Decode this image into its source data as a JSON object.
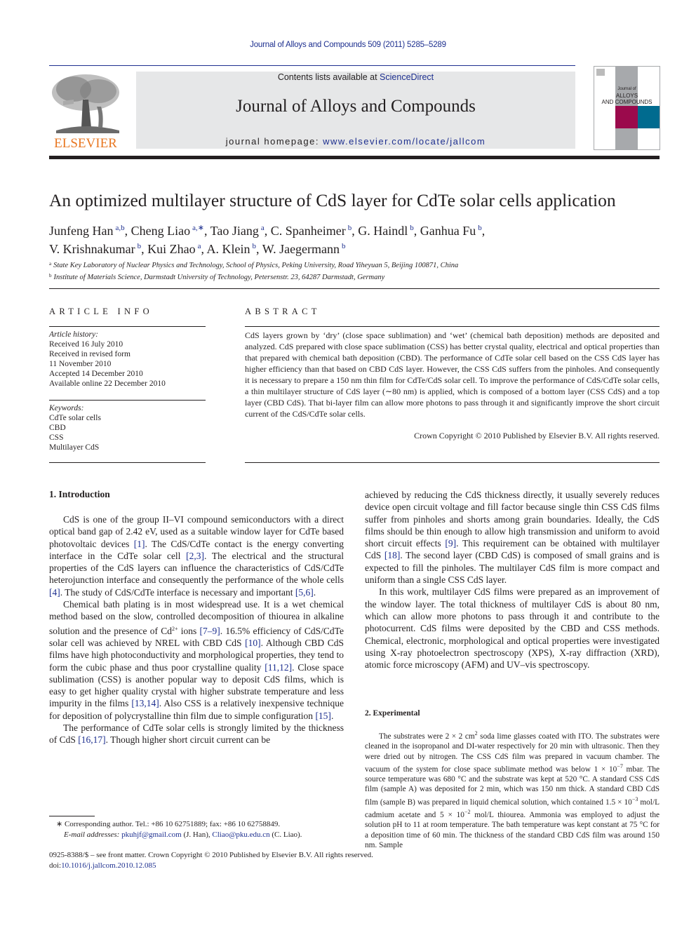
{
  "running_head": "Journal of Alloys and Compounds 509 (2011) 5285–5289",
  "masthead": {
    "publisher_logo_text": "ELSEVIER",
    "contents_prefix": "Contents lists available at ",
    "contents_link": "ScienceDirect",
    "journal_name": "Journal of Alloys and Compounds",
    "homepage_prefix": "journal homepage: ",
    "homepage_url": "www.elsevier.com/locate/jallcom",
    "cover_title_line1": "Journal of",
    "cover_title_line2": "ALLOYS",
    "cover_title_line3": "AND COMPOUNDS",
    "colors": {
      "brand_orange": "#e87722",
      "link_blue": "#1d2f8f",
      "cover_magenta": "#9b0a4c",
      "cover_teal": "#006b8f",
      "cover_gray": "#a7a9ac",
      "banner_gray": "#e6e7e8"
    }
  },
  "article": {
    "title": "An optimized multilayer structure of CdS layer for CdTe solar cells application",
    "authors": [
      {
        "name": "Junfeng Han",
        "aff": "a,b",
        "sep": ", "
      },
      {
        "name": "Cheng Liao",
        "aff": "a,∗",
        "sep": ", "
      },
      {
        "name": "Tao Jiang",
        "aff": "a",
        "sep": ", "
      },
      {
        "name": "C. Spanheimer",
        "aff": "b",
        "sep": ", "
      },
      {
        "name": "G. Haindl",
        "aff": "b",
        "sep": ", "
      },
      {
        "name": "Ganhua Fu",
        "aff": "b",
        "sep": ","
      },
      {
        "name": "V. Krishnakumar",
        "aff": "b",
        "sep": ", "
      },
      {
        "name": "Kui Zhao",
        "aff": "a",
        "sep": ", "
      },
      {
        "name": "A. Klein",
        "aff": "b",
        "sep": ", "
      },
      {
        "name": "W. Jaegermann",
        "aff": "b",
        "sep": ""
      }
    ],
    "affiliations": [
      {
        "mark": "a",
        "text": "State Key Laboratory of Nuclear Physics and Technology, School of Physics, Peking University, Road Yiheyuan 5, Beijing 100871, China"
      },
      {
        "mark": "b",
        "text": "Institute of Materials Science, Darmstadt University of Technology, Petersenstr. 23, 64287 Darmstadt, Germany"
      }
    ]
  },
  "article_info": {
    "heading": "ARTICLE INFO",
    "history_label": "Article history:",
    "history": [
      "Received 16 July 2010",
      "Received in revised form",
      "11 November 2010",
      "Accepted 14 December 2010",
      "Available online 22 December 2010"
    ],
    "keywords_label": "Keywords:",
    "keywords": [
      "CdTe solar cells",
      "CBD",
      "CSS",
      "Multilayer CdS"
    ]
  },
  "abstract": {
    "heading": "ABSTRACT",
    "text": "CdS layers grown by ‘dry’ (close space sublimation) and ‘wet’ (chemical bath deposition) methods are deposited and analyzed. CdS prepared with close space sublimation (CSS) has better crystal quality, electrical and optical properties than that prepared with chemical bath deposition (CBD). The performance of CdTe solar cell based on the CSS CdS layer has higher efficiency than that based on CBD CdS layer. However, the CSS CdS suffers from the pinholes. And consequently it is necessary to prepare a 150 nm thin film for CdTe/CdS solar cell. To improve the performance of CdS/CdTe solar cells, a thin multilayer structure of CdS layer (∼80 nm) is applied, which is composed of a bottom layer (CSS CdS) and a top layer (CBD CdS). That bi-layer film can allow more photons to pass through it and significantly improve the short circuit current of the CdS/CdTe solar cells.",
    "copyright": "Crown Copyright © 2010 Published by Elsevier B.V. All rights reserved."
  },
  "sections": {
    "intro_heading": "1.  Introduction",
    "intro_p1": [
      {
        "t": "CdS is one of the group II–VI compound semiconductors with a direct optical band gap of 2.42 eV, used as a suitable window layer for CdTe based photovoltaic devices "
      },
      {
        "ref": "[1]"
      },
      {
        "t": ". The CdS/CdTe contact is the energy converting interface in the CdTe solar cell "
      },
      {
        "ref": "[2,3]"
      },
      {
        "t": ". The electrical and the structural properties of the CdS layers can influence the characteristics of CdS/CdTe heterojunction interface and consequently the performance of the whole cells "
      },
      {
        "ref": "[4]"
      },
      {
        "t": ". The study of CdS/CdTe interface is necessary and important "
      },
      {
        "ref": "[5,6]"
      },
      {
        "t": "."
      }
    ],
    "intro_p2": [
      {
        "t": "Chemical bath plating is in most widespread use. It is a wet chemical method based on the slow, controlled decomposition of thiourea in alkaline solution and the presence of Cd"
      },
      {
        "sup": "2+"
      },
      {
        "t": " ions "
      },
      {
        "ref": "[7–9]"
      },
      {
        "t": ". 16.5% efficiency of CdS/CdTe solar cell was achieved by NREL with CBD CdS "
      },
      {
        "ref": "[10]"
      },
      {
        "t": ". Although CBD CdS films have high photoconductivity and morphological properties, they tend to form the cubic phase and thus poor crystalline quality "
      },
      {
        "ref": "[11,12]"
      },
      {
        "t": ". Close space sublimation (CSS) is another popular way to deposit CdS films, which is easy to get higher quality crystal with higher substrate temperature and less impurity in the films "
      },
      {
        "ref": "[13,14]"
      },
      {
        "t": ". Also CSS is a relatively inexpensive technique for deposition of polycrystalline thin film due to simple configuration "
      },
      {
        "ref": "[15]"
      },
      {
        "t": "."
      }
    ],
    "intro_p3": [
      {
        "t": "The performance of CdTe solar cells is strongly limited by the thickness of CdS "
      },
      {
        "ref": "[16,17]"
      },
      {
        "t": ". Though higher short circuit current can be achieved by reducing the CdS thickness directly, it usually severely reduces device open circuit voltage and fill factor because single thin CSS CdS films suffer from pinholes and shorts among grain boundaries. Ideally, the CdS films should be thin enough to allow high transmission and uniform to avoid short circuit effects "
      },
      {
        "ref": "[9]"
      },
      {
        "t": ". This requirement can be obtained with multilayer CdS "
      },
      {
        "ref": "[18]"
      },
      {
        "t": ". The second layer (CBD CdS) is composed of small grains and is expected to fill the pinholes. The multilayer CdS film is more compact and uniform than a single CSS CdS layer."
      }
    ],
    "intro_p4": [
      {
        "t": "In this work, multilayer CdS films were prepared as an improvement of the window layer. The total thickness of multilayer CdS is about 80 nm, which can allow more photons to pass through it and contribute to the photocurrent. CdS films were deposited by the CBD and CSS methods. Chemical, electronic, morphological and optical properties were investigated using X-ray photoelectron spectroscopy (XPS), X-ray diffraction (XRD), atomic force microscopy (AFM) and UV–vis spectroscopy."
      }
    ],
    "exp_heading": "2.  Experimental",
    "exp_p1": [
      {
        "t": "The substrates were 2 × 2 cm"
      },
      {
        "sup": "2"
      },
      {
        "t": " soda lime glasses coated with ITO. The substrates were cleaned in the isopropanol and DI-water respectively for 20 min with ultrasonic. Then they were dried out by nitrogen. The CSS CdS film was prepared in vacuum chamber. The vacuum of the system for close space sublimate method was below 1 × 10"
      },
      {
        "sup": "−7"
      },
      {
        "t": " mbar. The source temperature was 680 °C and the substrate was kept at 520 °C. A standard CSS CdS film (sample A) was deposited for 2 min, which was 150 nm thick. A standard CBD CdS film (sample B) was prepared in liquid chemical solution, which contained 1.5 × 10"
      },
      {
        "sup": "−3"
      },
      {
        "t": " mol/L cadmium acetate and 5 × 10"
      },
      {
        "sup": "−2"
      },
      {
        "t": " mol/L thiourea. Ammonia was employed to adjust the solution pH to 11 at room temperature. The bath temperature was kept constant at 75 °C for a deposition time of 60 min. The thickness of the standard CBD CdS film was around 150 nm. Sample"
      }
    ]
  },
  "footnote": {
    "mark": "∗",
    "line1": "Corresponding author. Tel.: +86 10 62751889; fax: +86 10 62758849.",
    "email_label": "E-mail addresses:",
    "email1": "pkuhjf@gmail.com",
    "email1_owner": " (J. Han), ",
    "email2": "Cliao@pku.edu.cn",
    "email2_owner": " (C. Liao)."
  },
  "bottom": {
    "issn_line": "0925-8388/$ – see front matter. Crown Copyright © 2010 Published by Elsevier B.V. All rights reserved.",
    "doi_prefix": "doi:",
    "doi": "10.1016/j.jallcom.2010.12.085"
  }
}
